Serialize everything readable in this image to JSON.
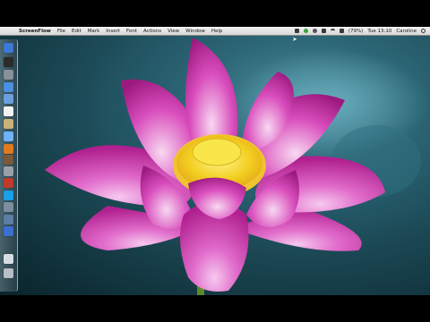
{
  "menubar": {
    "app_name": "ScreenFlow",
    "items": [
      "File",
      "Edit",
      "Mark",
      "Insert",
      "Font",
      "Actions",
      "View",
      "Window",
      "Help"
    ],
    "status": {
      "battery": "(79%)",
      "clock": "Tue 13:10",
      "user": "Caroline"
    }
  },
  "dock": {
    "icons": [
      {
        "name": "finder-icon",
        "color": "#3f79d6"
      },
      {
        "name": "dashboard-icon",
        "color": "#2b2b2b"
      },
      {
        "name": "launchpad-icon",
        "color": "#8a8f99"
      },
      {
        "name": "safari-icon",
        "color": "#4a8fe0"
      },
      {
        "name": "mail-icon",
        "color": "#6aa0e0"
      },
      {
        "name": "calendar-icon",
        "color": "#f2f2f2"
      },
      {
        "name": "photos-icon",
        "color": "#c9b27a"
      },
      {
        "name": "itunes-icon",
        "color": "#6db4ff"
      },
      {
        "name": "firefox-icon",
        "color": "#e07a1e"
      },
      {
        "name": "app-icon",
        "color": "#7a5a3a"
      },
      {
        "name": "system-preferences-icon",
        "color": "#9aa0a8"
      },
      {
        "name": "screenflow-icon",
        "color": "#c03a2a"
      },
      {
        "name": "skype-icon",
        "color": "#1aa0e6"
      },
      {
        "name": "utility-icon",
        "color": "#7f8e9e"
      },
      {
        "name": "preview-icon",
        "color": "#5c7ea6"
      },
      {
        "name": "app-store-icon",
        "color": "#3b6fd1"
      },
      {
        "name": "documents-folder-icon",
        "color": "#d8dde3"
      },
      {
        "name": "trash-icon",
        "color": "#b8bec6"
      }
    ]
  },
  "wallpaper": {
    "subject": "pink lotus flower",
    "colors": {
      "petal": "#d13fb1",
      "petal_light": "#f3a7e4",
      "center": "#f4d32a",
      "background": "#1b4854"
    }
  }
}
